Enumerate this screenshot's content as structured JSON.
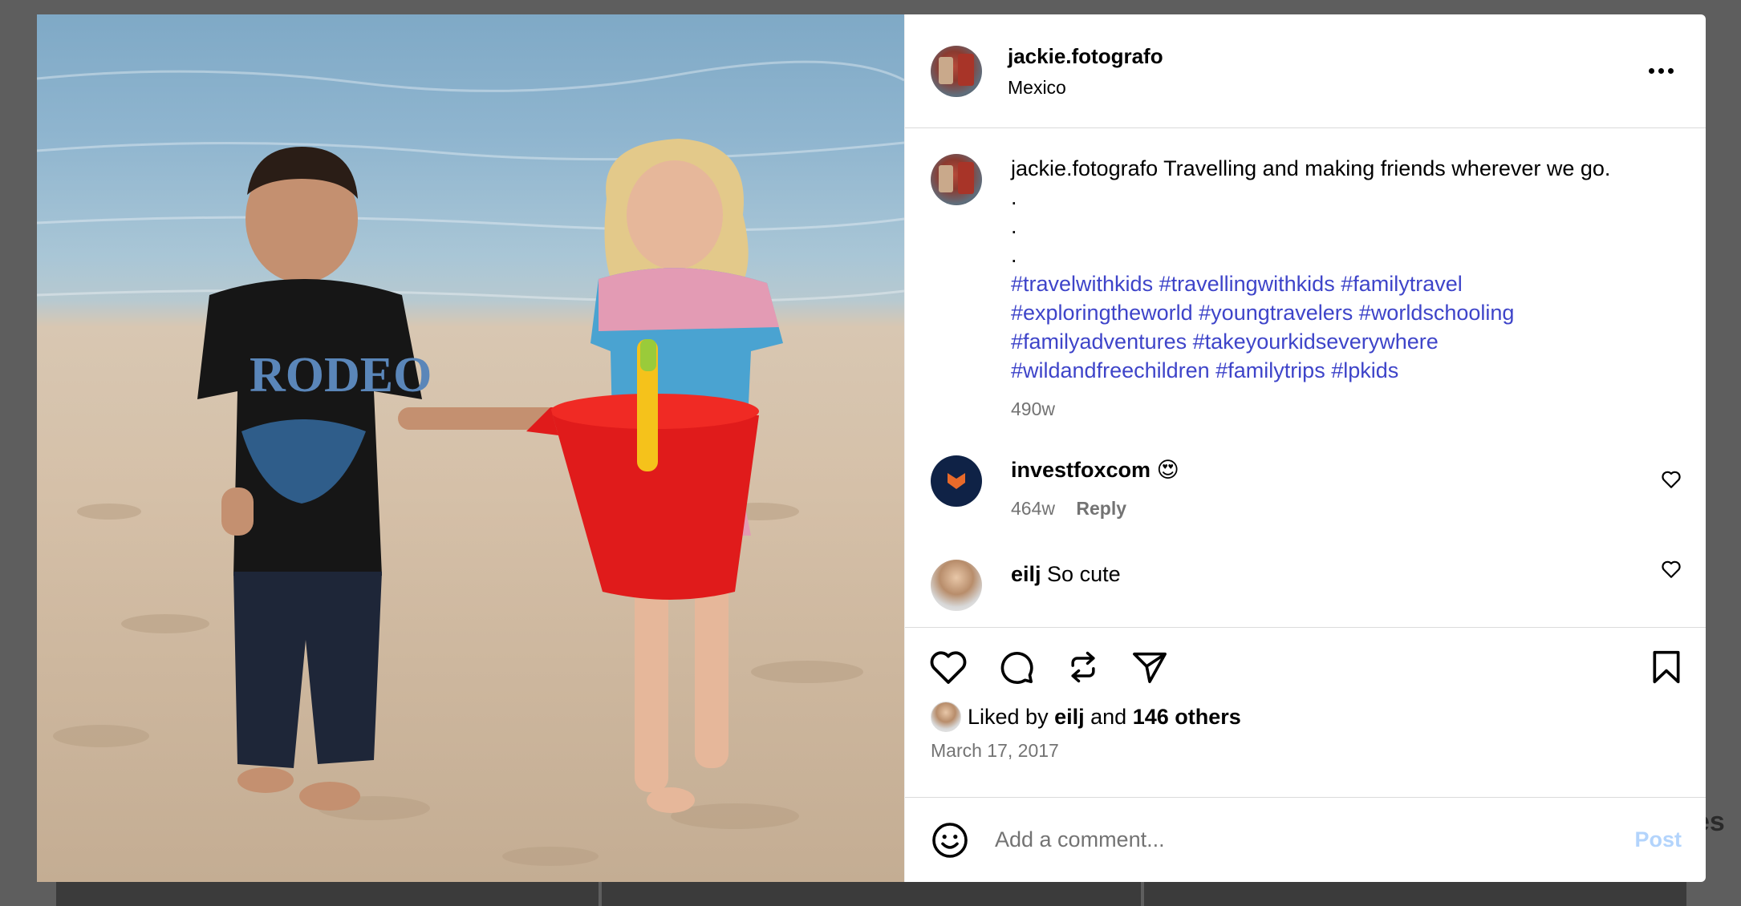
{
  "colors": {
    "hashtag": "#3e44c9",
    "muted": "#737373",
    "post_disabled": "#b3d4fc",
    "overlay": "#5e5e5e"
  },
  "background_text": "es",
  "post": {
    "image_description_icon": "photo",
    "header": {
      "username": "jackie.fotografo",
      "location": "Mexico",
      "more_icon": "more-horizontal-icon"
    },
    "caption": {
      "username": "jackie.fotografo",
      "text": "Travelling and making friends wherever we go.",
      "dots": [
        ".",
        ".",
        "."
      ],
      "hashtags": [
        "#travelwithkids",
        "#travellingwithkids",
        "#familytravel",
        "#exploringtheworld",
        "#youngtravelers",
        "#worldschooling",
        "#familyadventures",
        "#takeyourkidseverywhere",
        "#wildandfreechildren",
        "#familytrips",
        "#lpkids"
      ],
      "age": "490w"
    },
    "comments": [
      {
        "username": "investfoxcom",
        "text": "😍",
        "age": "464w",
        "reply_label": "Reply"
      },
      {
        "username": "eilj",
        "text": "So cute"
      }
    ],
    "actions": {
      "like_icon": "heart-icon",
      "comment_icon": "comment-icon",
      "repost_icon": "repost-icon",
      "share_icon": "send-icon",
      "save_icon": "bookmark-icon"
    },
    "likes": {
      "prefix": "Liked by",
      "user": "eilj",
      "joiner": "and",
      "others": "146 others"
    },
    "date": "March 17, 2017",
    "add_comment": {
      "placeholder": "Add a comment...",
      "post_label": "Post",
      "emoji_icon": "emoji-icon"
    }
  }
}
